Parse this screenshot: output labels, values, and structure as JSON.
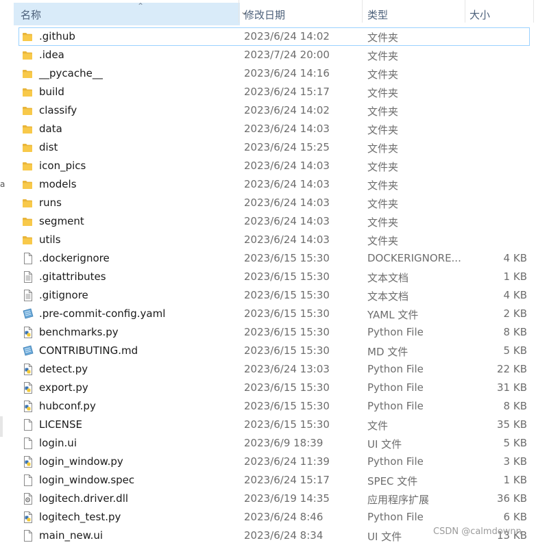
{
  "header": {
    "name_label": "名称",
    "date_label": "修改日期",
    "type_label": "类型",
    "size_label": "大小"
  },
  "files": [
    {
      "name": ".github",
      "date": "2023/6/24 14:02",
      "type": "文件夹",
      "size": "",
      "icon": "folder-icon"
    },
    {
      "name": ".idea",
      "date": "2023/7/24 20:00",
      "type": "文件夹",
      "size": "",
      "icon": "folder-icon"
    },
    {
      "name": "__pycache__",
      "date": "2023/6/24 14:16",
      "type": "文件夹",
      "size": "",
      "icon": "folder-icon"
    },
    {
      "name": "build",
      "date": "2023/6/24 15:17",
      "type": "文件夹",
      "size": "",
      "icon": "folder-icon"
    },
    {
      "name": "classify",
      "date": "2023/6/24 14:02",
      "type": "文件夹",
      "size": "",
      "icon": "folder-icon"
    },
    {
      "name": "data",
      "date": "2023/6/24 14:03",
      "type": "文件夹",
      "size": "",
      "icon": "folder-icon"
    },
    {
      "name": "dist",
      "date": "2023/6/24 15:25",
      "type": "文件夹",
      "size": "",
      "icon": "folder-icon"
    },
    {
      "name": "icon_pics",
      "date": "2023/6/24 14:03",
      "type": "文件夹",
      "size": "",
      "icon": "folder-icon"
    },
    {
      "name": "models",
      "date": "2023/6/24 14:03",
      "type": "文件夹",
      "size": "",
      "icon": "folder-icon"
    },
    {
      "name": "runs",
      "date": "2023/6/24 14:03",
      "type": "文件夹",
      "size": "",
      "icon": "folder-icon"
    },
    {
      "name": "segment",
      "date": "2023/6/24 14:03",
      "type": "文件夹",
      "size": "",
      "icon": "folder-icon"
    },
    {
      "name": "utils",
      "date": "2023/6/24 14:03",
      "type": "文件夹",
      "size": "",
      "icon": "folder-icon"
    },
    {
      "name": ".dockerignore",
      "date": "2023/6/15 15:30",
      "type": "DOCKERIGNORE...",
      "size": "4 KB",
      "icon": "blank-file-icon"
    },
    {
      "name": ".gitattributes",
      "date": "2023/6/15 15:30",
      "type": "文本文档",
      "size": "1 KB",
      "icon": "text-file-icon"
    },
    {
      "name": ".gitignore",
      "date": "2023/6/15 15:30",
      "type": "文本文档",
      "size": "4 KB",
      "icon": "text-file-icon"
    },
    {
      "name": ".pre-commit-config.yaml",
      "date": "2023/6/15 15:30",
      "type": "YAML 文件",
      "size": "2 KB",
      "icon": "notepad-file-icon"
    },
    {
      "name": "benchmarks.py",
      "date": "2023/6/15 15:30",
      "type": "Python File",
      "size": "8 KB",
      "icon": "python-file-icon"
    },
    {
      "name": "CONTRIBUTING.md",
      "date": "2023/6/15 15:30",
      "type": "MD 文件",
      "size": "5 KB",
      "icon": "notepad-file-icon"
    },
    {
      "name": "detect.py",
      "date": "2023/6/24 13:03",
      "type": "Python File",
      "size": "22 KB",
      "icon": "python-file-icon"
    },
    {
      "name": "export.py",
      "date": "2023/6/15 15:30",
      "type": "Python File",
      "size": "31 KB",
      "icon": "python-file-icon"
    },
    {
      "name": "hubconf.py",
      "date": "2023/6/15 15:30",
      "type": "Python File",
      "size": "8 KB",
      "icon": "python-file-icon"
    },
    {
      "name": "LICENSE",
      "date": "2023/6/15 15:30",
      "type": "文件",
      "size": "35 KB",
      "icon": "blank-file-icon"
    },
    {
      "name": "login.ui",
      "date": "2023/6/9 18:39",
      "type": "UI 文件",
      "size": "5 KB",
      "icon": "blank-file-icon"
    },
    {
      "name": "login_window.py",
      "date": "2023/6/24 11:39",
      "type": "Python File",
      "size": "3 KB",
      "icon": "python-file-icon"
    },
    {
      "name": "login_window.spec",
      "date": "2023/6/24 15:17",
      "type": "SPEC 文件",
      "size": "1 KB",
      "icon": "blank-file-icon"
    },
    {
      "name": "logitech.driver.dll",
      "date": "2023/6/19 14:35",
      "type": "应用程序扩展",
      "size": "36 KB",
      "icon": "dll-file-icon"
    },
    {
      "name": "logitech_test.py",
      "date": "2023/6/24 8:46",
      "type": "Python File",
      "size": "6 KB",
      "icon": "python-file-icon"
    },
    {
      "name": "main_new.ui",
      "date": "2023/6/24 8:34",
      "type": "UI 文件",
      "size": "13 KB",
      "icon": "blank-file-icon"
    }
  ],
  "selected_index": 0,
  "watermark": "CSDN @calmdownn",
  "left_edge_char": "a",
  "colors": {
    "folder": "#f8c94a",
    "selection_border": "#99d1ff",
    "header_active_bg": "#d9ebf9"
  }
}
